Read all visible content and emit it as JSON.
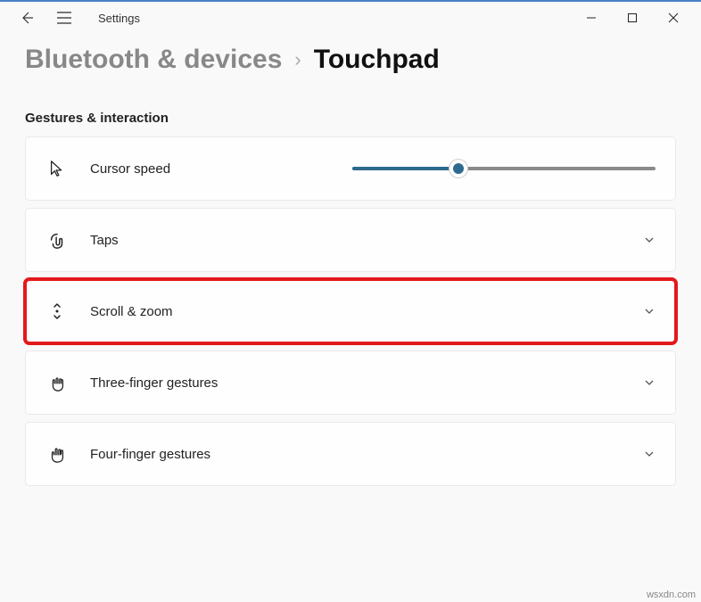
{
  "app_title": "Settings",
  "breadcrumb": {
    "parent": "Bluetooth & devices",
    "current": "Touchpad"
  },
  "section_title": "Gestures & interaction",
  "rows": {
    "cursor_speed": {
      "label": "Cursor speed",
      "slider_percent": 35
    },
    "taps": {
      "label": "Taps"
    },
    "scroll_zoom": {
      "label": "Scroll & zoom"
    },
    "three_finger": {
      "label": "Three-finger gestures"
    },
    "four_finger": {
      "label": "Four-finger gestures"
    }
  },
  "watermark": "wsxdn.com"
}
